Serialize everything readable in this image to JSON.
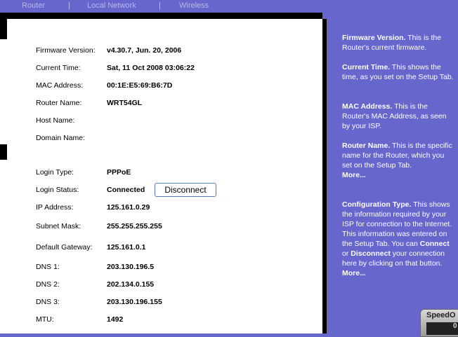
{
  "tabs": [
    {
      "label": "Router"
    },
    {
      "label": "Local Network"
    },
    {
      "label": "Wireless"
    }
  ],
  "tab_separator": "|",
  "info": {
    "firmware_version": {
      "label": "Firmware Version:",
      "value": "v4.30.7, Jun. 20, 2006"
    },
    "current_time": {
      "label": "Current Time:",
      "value": "Sat, 11 Oct 2008 03:06:22"
    },
    "mac_address": {
      "label": "MAC Address:",
      "value": "00:1E:E5:69:B6:7D"
    },
    "router_name": {
      "label": "Router Name:",
      "value": "WRT54GL"
    },
    "host_name": {
      "label": "Host Name:",
      "value": ""
    },
    "domain_name": {
      "label": "Domain Name:",
      "value": ""
    },
    "login_type": {
      "label": "Login Type:",
      "value": "PPPoE"
    },
    "login_status": {
      "label": "Login Status:",
      "value": "Connected"
    },
    "ip_address": {
      "label": "IP Address:",
      "value": "125.161.0.29"
    },
    "subnet_mask": {
      "label": "Subnet Mask:",
      "value": "255.255.255.255"
    },
    "default_gateway": {
      "label": "Default Gateway:",
      "value": "125.161.0.1"
    },
    "dns1": {
      "label": "DNS 1:",
      "value": "203.130.196.5"
    },
    "dns2": {
      "label": "DNS 2:",
      "value": "202.134.0.155"
    },
    "dns3": {
      "label": "DNS 3:",
      "value": "203.130.196.155"
    },
    "mtu": {
      "label": "MTU:",
      "value": "1492"
    }
  },
  "disconnect_label": "Disconnect",
  "help": {
    "firmware_title": "Firmware Version.",
    "firmware_text": " This is the Router's current firmware.",
    "time_title": "Current Time.",
    "time_text": " This shows the time, as you set on the Setup Tab.",
    "mac_title": "MAC Address.",
    "mac_text": " This is the Router's MAC Address, as seen by your ISP.",
    "router_title": "Router Name.",
    "router_text": " This is the specific name for the Router, which you set on the Setup Tab.",
    "more1": "More...",
    "config_title": "Configuration Type.",
    "config_text1": " This shows the information required by your ISP for connection to the Internet. This information was entered on the Setup Tab. You can ",
    "config_connect": "Connect",
    "config_or": " or ",
    "config_disconnect": "Disconnect",
    "config_text2": " your connection here by clicking on that button.",
    "more2": "More..."
  },
  "speed_widget": {
    "label": "SpeedO",
    "inner": "0"
  }
}
